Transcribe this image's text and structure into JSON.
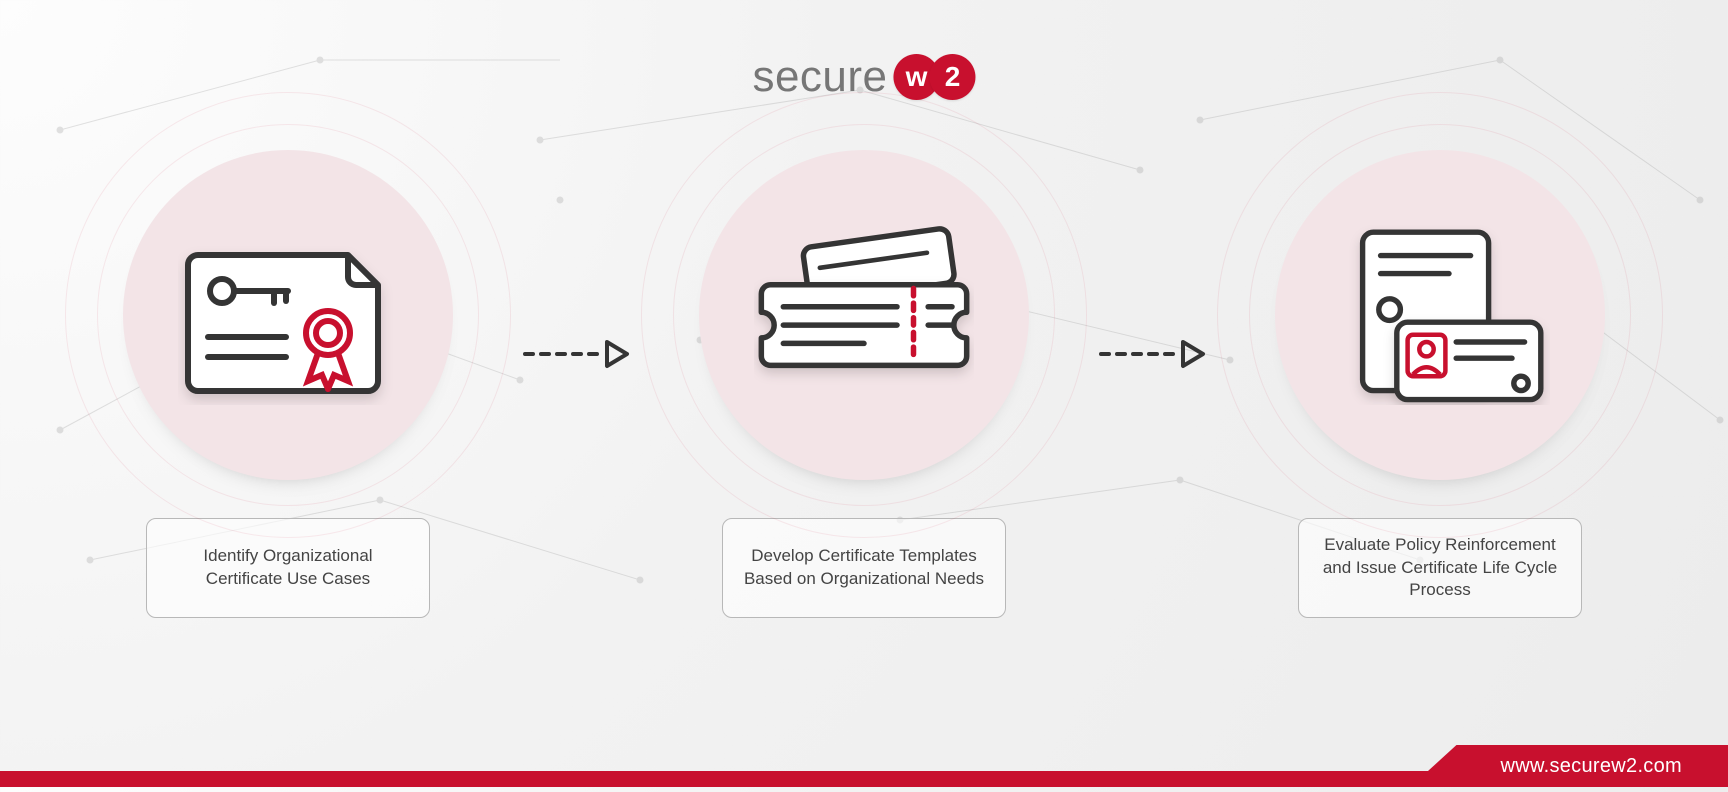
{
  "brand": {
    "word_part1": "secure",
    "badge_letters": [
      "w",
      "2"
    ]
  },
  "steps": [
    {
      "icon": "certificate-key-icon",
      "caption": "Identify Organizational Certificate Use Cases"
    },
    {
      "icon": "template-ticket-icon",
      "caption": "Develop Certificate Templates Based on Organizational Needs"
    },
    {
      "icon": "policy-id-card-icon",
      "caption": "Evaluate Policy Reinforcement and Issue Certificate Life Cycle Process"
    }
  ],
  "footer": {
    "url": "www.securew2.com"
  },
  "colors": {
    "brand_red": "#c8102e",
    "ink": "#343434"
  }
}
